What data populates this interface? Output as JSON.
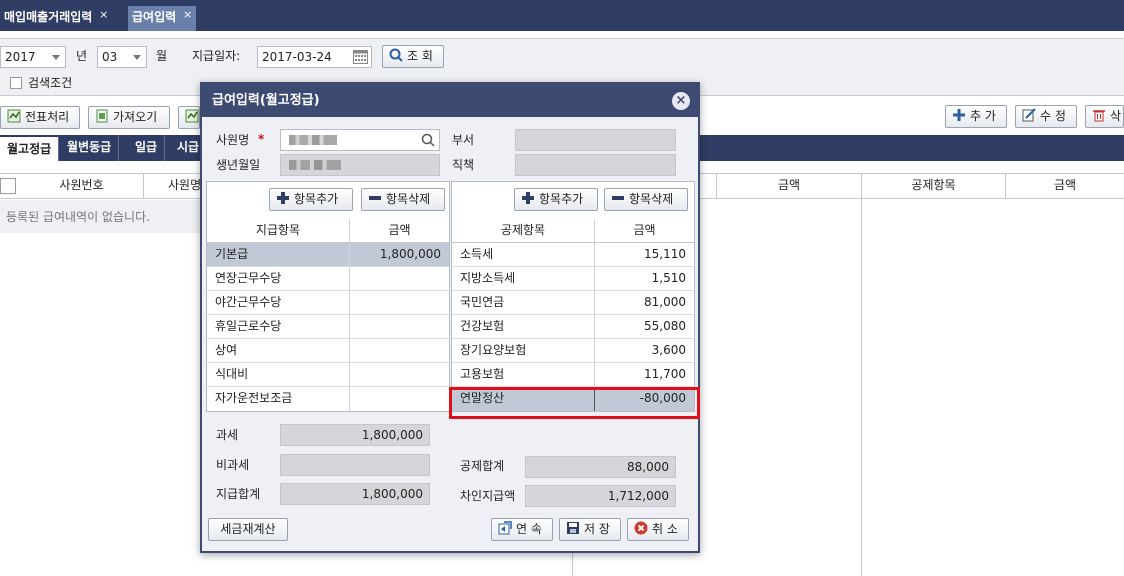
{
  "tabs": [
    {
      "label": "매입매출거래입력",
      "close": "×"
    },
    {
      "label": "급여입력",
      "close": "×"
    }
  ],
  "filter": {
    "year": "2017",
    "year_unit": "년",
    "month": "03",
    "month_unit": "월",
    "pay_date_label": "지급일자:",
    "pay_date": "2017-03-24",
    "search_button": "조 회",
    "search_condition_label": "검색조건"
  },
  "toolbar": {
    "voucher_button": "전표처리",
    "import_button": "가져오기",
    "add_button": "추 가",
    "edit_button": "수 정",
    "delete_button": "삭"
  },
  "subtabs": [
    "월고정급",
    "월변동급",
    "일급",
    "시급"
  ],
  "grid": {
    "headers": [
      "사원번호",
      "사원명"
    ],
    "right_headers": [
      "금액",
      "공제항목",
      "금액"
    ],
    "empty_message": "등록된 급여내역이 없습니다."
  },
  "modal": {
    "title": "급여입력(월고정급)",
    "employee_label": "사원명",
    "required_mark": "*",
    "birth_label": "생년월일",
    "dept_label": "부서",
    "position_label": "직책",
    "add_item_button": "항목추가",
    "delete_item_button": "항목삭제",
    "pay_table": {
      "headers": [
        "지급항목",
        "금액"
      ],
      "rows": [
        {
          "name": "기본급",
          "amount": "1,800,000"
        },
        {
          "name": "연장근무수당",
          "amount": ""
        },
        {
          "name": "야간근무수당",
          "amount": ""
        },
        {
          "name": "휴일근로수당",
          "amount": ""
        },
        {
          "name": "상여",
          "amount": ""
        },
        {
          "name": "식대비",
          "amount": ""
        },
        {
          "name": "자가운전보조금",
          "amount": ""
        }
      ]
    },
    "deduct_table": {
      "headers": [
        "공제항목",
        "금액"
      ],
      "rows": [
        {
          "name": "소득세",
          "amount": "15,110"
        },
        {
          "name": "지방소득세",
          "amount": "1,510"
        },
        {
          "name": "국민연금",
          "amount": "81,000"
        },
        {
          "name": "건강보험",
          "amount": "55,080"
        },
        {
          "name": "장기요양보험",
          "amount": "3,600"
        },
        {
          "name": "고용보험",
          "amount": "11,700"
        },
        {
          "name": "연말정산",
          "amount": "-80,000"
        }
      ]
    },
    "summary": {
      "taxable_label": "과세",
      "taxable": "1,800,000",
      "nontaxable_label": "비과세",
      "nontaxable": "",
      "total_pay_label": "지급합계",
      "total_pay": "1,800,000",
      "total_deduct_label": "공제합계",
      "total_deduct": "88,000",
      "net_pay_label": "차인지급액",
      "net_pay": "1,712,000"
    },
    "recalc_button": "세금재계산",
    "continue_button": "연 속",
    "save_button": "저 장",
    "cancel_button": "취 소"
  },
  "colors": {
    "header_navy": "#2f3d64",
    "active_tab": "#6a7faa",
    "highlight_box": "#e0101a",
    "selected_row": "#c2c9d6"
  },
  "icons": [
    "close-icon",
    "chevron-down-icon",
    "calendar-icon",
    "search-icon",
    "checkbox-icon",
    "voucher-icon",
    "import-icon",
    "plus-icon",
    "edit-icon",
    "trash-icon",
    "minus-icon",
    "continue-icon",
    "save-icon",
    "cancel-icon"
  ]
}
